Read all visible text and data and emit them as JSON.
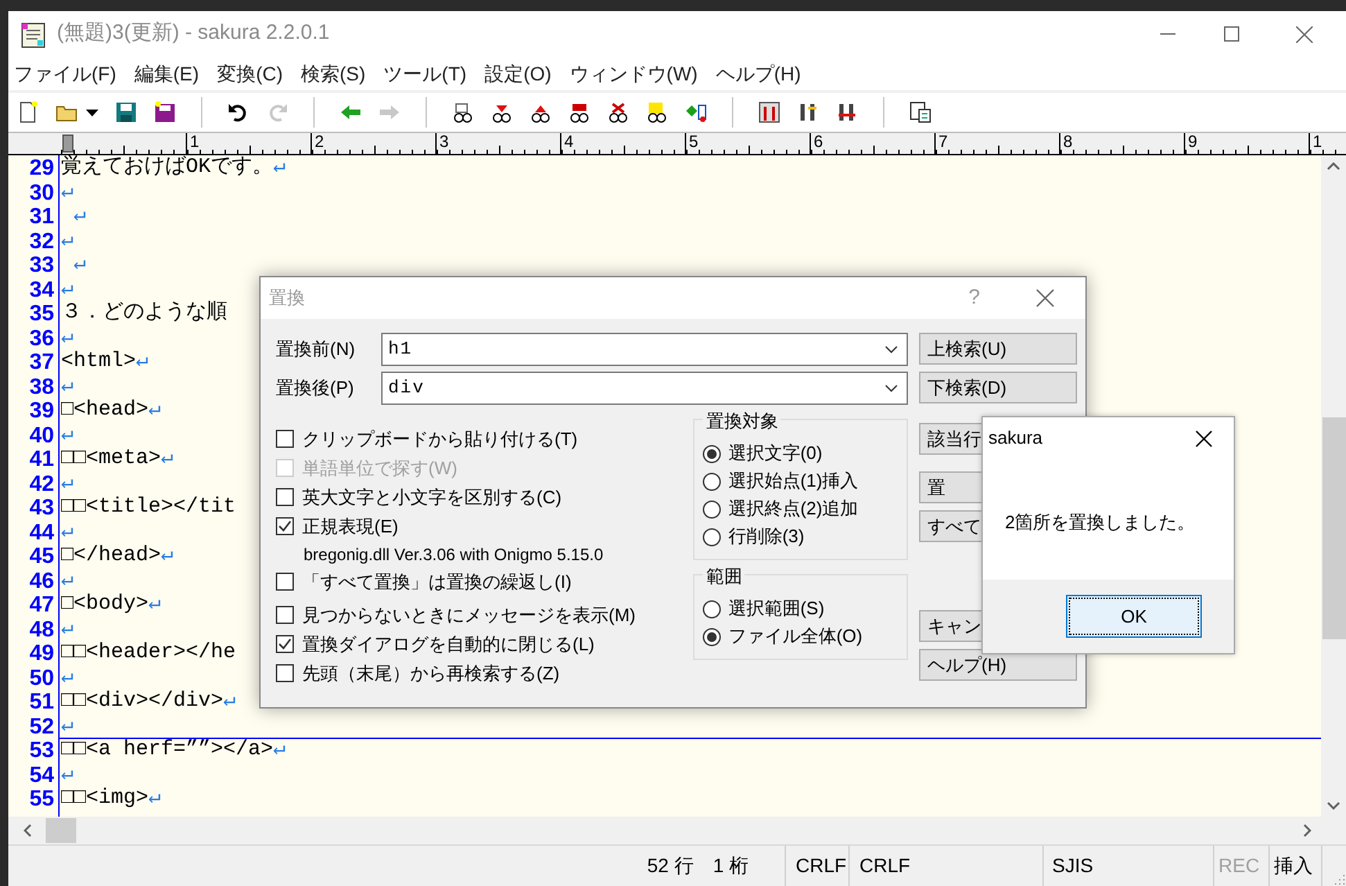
{
  "window": {
    "title": "(無題)3(更新) - sakura 2.2.0.1"
  },
  "menu": [
    "ファイル(F)",
    "編集(E)",
    "変換(C)",
    "検索(S)",
    "ツール(T)",
    "設定(O)",
    "ウィンドウ(W)",
    "ヘルプ(H)"
  ],
  "ruler": {
    "labels": [
      "1",
      "2",
      "3",
      "4",
      "5",
      "6",
      "7",
      "8",
      "9",
      "1"
    ]
  },
  "editor": {
    "lines": [
      {
        "number": "29",
        "text": "覚えておけばOKです。",
        "eol": "↵",
        "current": false
      },
      {
        "number": "30",
        "eol": "↵",
        "current": false
      },
      {
        "number": "31",
        "eol": " ↵",
        "current": false
      },
      {
        "number": "32",
        "eol": "↵",
        "current": false
      },
      {
        "number": "33",
        "eol": " ↵",
        "current": false
      },
      {
        "number": "34",
        "eol": "↵",
        "current": false
      },
      {
        "number": "35",
        "text": "３．どのような順",
        "current": false
      },
      {
        "number": "36",
        "eol": "↵",
        "current": false
      },
      {
        "number": "37",
        "text": "<html>",
        "eol": "↵",
        "current": false
      },
      {
        "number": "38",
        "eol": "↵",
        "current": false
      },
      {
        "number": "39",
        "text": "□<head>",
        "eol": "↵",
        "current": false
      },
      {
        "number": "40",
        "eol": "↵",
        "current": false
      },
      {
        "number": "41",
        "text": "□□<meta>",
        "eol": "↵",
        "current": false
      },
      {
        "number": "42",
        "eol": "↵",
        "current": false
      },
      {
        "number": "43",
        "text": "□□<title></tit",
        "current": false
      },
      {
        "number": "44",
        "eol": "↵",
        "current": false
      },
      {
        "number": "45",
        "text": "□</head>",
        "eol": "↵",
        "current": false
      },
      {
        "number": "46",
        "eol": "↵",
        "current": false
      },
      {
        "number": "47",
        "text": "□<body>",
        "eol": "↵",
        "current": false
      },
      {
        "number": "48",
        "eol": "↵",
        "current": false
      },
      {
        "number": "49",
        "text": "□□<header></he",
        "current": false
      },
      {
        "number": "50",
        "eol": "↵",
        "current": false
      },
      {
        "number": "51",
        "text": "□□<div></div>",
        "eol": "↵",
        "current": false
      },
      {
        "number": "52",
        "eol": "↵",
        "current": true
      },
      {
        "number": "53",
        "text": "□□<a herf=””></a>",
        "eol": "↵",
        "current": false
      },
      {
        "number": "54",
        "eol": "↵",
        "current": false
      },
      {
        "number": "55",
        "text": "□□<img>",
        "eol": "↵",
        "current": false
      }
    ]
  },
  "status_bar": [
    {
      "text": "52 行　1 桁",
      "disabled": false
    },
    {
      "text": "CRLF",
      "disabled": false
    },
    {
      "text": "CRLF",
      "disabled": false
    },
    {
      "text": "SJIS",
      "disabled": false
    },
    {
      "text": "REC",
      "disabled": true
    },
    {
      "text": "挿入",
      "disabled": false
    }
  ],
  "replace_dialog": {
    "title": "置換",
    "help": "?",
    "fields": [
      {
        "label": "置換前(N)",
        "value": "h1"
      },
      {
        "label": "置換後(P)",
        "value": "div"
      }
    ],
    "options": [
      {
        "kind": "checkbox",
        "label": "クリップボードから貼り付ける(T)",
        "checked": false,
        "disabled": false
      },
      {
        "kind": "checkbox",
        "label": "単語単位で探す(W)",
        "checked": false,
        "disabled": true
      },
      {
        "kind": "checkbox",
        "label": "英大文字と小文字を区別する(C)",
        "checked": false,
        "disabled": false
      },
      {
        "kind": "checkbox",
        "label": "正規表現(E)",
        "checked": true,
        "disabled": false
      },
      {
        "kind": "note",
        "label": "bregonig.dll Ver.3.06 with Onigmo 5.15.0"
      },
      {
        "kind": "checkbox",
        "label": "「すべて置換」は置換の繰返し(I)",
        "checked": false,
        "disabled": false
      },
      {
        "kind": "checkbox",
        "label": "見つからないときにメッセージを表示(M)",
        "checked": false,
        "disabled": false
      },
      {
        "kind": "checkbox",
        "label": "置換ダイアログを自動的に閉じる(L)",
        "checked": true,
        "disabled": false
      },
      {
        "kind": "checkbox",
        "label": "先頭（末尾）から再検索する(Z)",
        "checked": false,
        "disabled": false
      }
    ],
    "groups": [
      {
        "title": "置換対象",
        "options": [
          {
            "label": "選択文字(0)",
            "selected": true
          },
          {
            "label": "選択始点(1)挿入",
            "selected": false
          },
          {
            "label": "選択終点(2)追加",
            "selected": false
          },
          {
            "label": "行削除(3)",
            "selected": false
          }
        ]
      },
      {
        "title": "範囲",
        "options": [
          {
            "label": "選択範囲(S)",
            "selected": false
          },
          {
            "label": "ファイル全体(O)",
            "selected": true
          }
        ]
      }
    ],
    "buttons": [
      [
        "上検索(U)",
        "下検索(D)"
      ],
      [
        "該当行"
      ],
      [
        "置",
        "すべて"
      ],
      [
        "キャン",
        "ヘルプ(H)"
      ]
    ]
  },
  "message_box": {
    "title": "sakura",
    "message": "2箇所を置換しました。",
    "button": "OK"
  }
}
